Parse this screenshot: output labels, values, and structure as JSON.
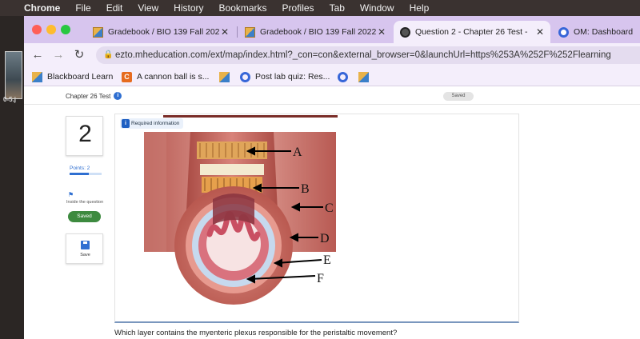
{
  "menubar": {
    "app": "Chrome",
    "items": [
      "File",
      "Edit",
      "View",
      "History",
      "Bookmarks",
      "Profiles",
      "Tab",
      "Window",
      "Help"
    ]
  },
  "desktop": {
    "label": "0-5.j"
  },
  "tabs": [
    {
      "label": "Gradebook / BIO 139 Fall 2022",
      "icon": "blackboard-icon",
      "active": false
    },
    {
      "label": "Gradebook / BIO 139 Fall 2022",
      "icon": "blackboard-icon",
      "active": false
    },
    {
      "label": "Question 2 - Chapter 26 Test -",
      "icon": "globe-icon",
      "active": true
    },
    {
      "label": "OM: Dashboard",
      "icon": "om-icon",
      "active": false
    }
  ],
  "address": {
    "url": "ezto.mheducation.com/ext/map/index.html?_con=con&external_browser=0&launchUrl=https%253A%252F%252Flearning"
  },
  "bookmarks": [
    {
      "label": "Blackboard Learn",
      "icon": "blackboard-icon"
    },
    {
      "label": "A cannon ball is s...",
      "icon": "chegg-icon",
      "letter": "C"
    },
    {
      "label": "",
      "icon": "blackboard-icon"
    },
    {
      "label": "Post lab quiz: Res...",
      "icon": "quizlet-icon"
    },
    {
      "label": "",
      "icon": "quizlet-icon"
    },
    {
      "label": "",
      "icon": "blackboard-icon"
    }
  ],
  "page": {
    "breadcrumb": "Chapter 26 Test",
    "header_pill": "Saved",
    "question_number": "2",
    "points_label": "Points: 2",
    "points_fraction": 0.6,
    "help_text": "Inside the question",
    "saved_button": "Saved",
    "save_label": "Save",
    "required_tag": "Required information",
    "required_num": "i",
    "figure_labels": [
      "A",
      "B",
      "C",
      "D",
      "E",
      "F"
    ],
    "question_text": "Which layer contains the myenteric plexus responsible for the peristaltic movement?"
  },
  "colors": {
    "tabstrip": "#d7c5ee",
    "toolbar": "#f4eefb",
    "accent": "#2f6fd1",
    "saved": "#3d8a3f"
  }
}
